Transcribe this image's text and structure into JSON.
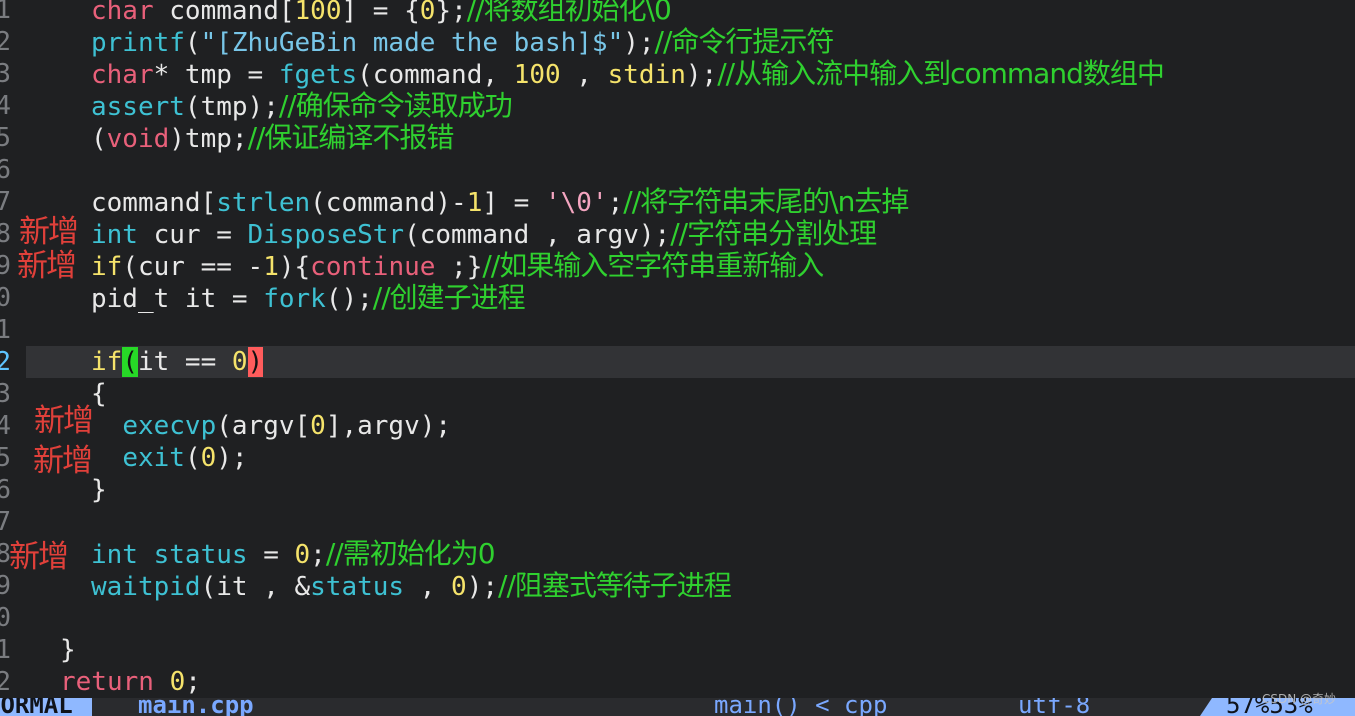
{
  "editor": {
    "lines": [
      {
        "num": "1",
        "code": [
          [
            "tok-type",
            "char"
          ],
          [
            "tok-plain",
            " command["
          ],
          [
            "tok-num",
            "100"
          ],
          [
            "tok-plain",
            "] = {"
          ],
          [
            "tok-num",
            "0"
          ],
          [
            "tok-plain",
            "};"
          ],
          [
            "cmt",
            "//将数组初始化\\0"
          ]
        ]
      },
      {
        "num": "2",
        "code": [
          [
            "tok-fn",
            "printf"
          ],
          [
            "tok-plain",
            "("
          ],
          [
            "tok-str",
            "\"[ZhuGeBin made the bash]$\""
          ],
          [
            "tok-plain",
            ");"
          ],
          [
            "cmt",
            "//命令行提示符"
          ]
        ]
      },
      {
        "num": "3",
        "code": [
          [
            "tok-type",
            "char"
          ],
          [
            "tok-plain",
            "* tmp = "
          ],
          [
            "tok-fn",
            "fgets"
          ],
          [
            "tok-plain",
            "(command, "
          ],
          [
            "tok-num",
            "100"
          ],
          [
            "tok-plain",
            " , "
          ],
          [
            "tok-num",
            "stdin"
          ],
          [
            "tok-plain",
            ");"
          ],
          [
            "cmt",
            "//从输入流中输入到command数组中"
          ]
        ]
      },
      {
        "num": "4",
        "code": [
          [
            "tok-fn",
            "assert"
          ],
          [
            "tok-plain",
            "(tmp);"
          ],
          [
            "cmt",
            "//确保命令读取成功"
          ]
        ]
      },
      {
        "num": "5",
        "code": [
          [
            "tok-plain",
            "("
          ],
          [
            "tok-type",
            "void"
          ],
          [
            "tok-plain",
            ")tmp;"
          ],
          [
            "cmt",
            "//保证编译不报错"
          ]
        ]
      },
      {
        "num": "6",
        "code": []
      },
      {
        "num": "7",
        "code": [
          [
            "tok-plain",
            "command["
          ],
          [
            "tok-fn",
            "strlen"
          ],
          [
            "tok-plain",
            "(command)-"
          ],
          [
            "tok-num",
            "1"
          ],
          [
            "tok-plain",
            "] = "
          ],
          [
            "tok-chr",
            "'\\0'"
          ],
          [
            "tok-plain",
            ";"
          ],
          [
            "cmt",
            "//将字符串末尾的\\n去掉"
          ]
        ]
      },
      {
        "num": "8",
        "code": [
          [
            "tok-fn",
            "int"
          ],
          [
            "tok-plain",
            " cur = "
          ],
          [
            "tok-fn",
            "DisposeStr"
          ],
          [
            "tok-plain",
            "(command , argv);"
          ],
          [
            "cmt",
            "//字符串分割处理"
          ]
        ]
      },
      {
        "num": "9",
        "code": [
          [
            "tok-kw",
            "if"
          ],
          [
            "tok-plain",
            "(cur == -"
          ],
          [
            "tok-num",
            "1"
          ],
          [
            "tok-plain",
            "){"
          ],
          [
            "tok-ctl",
            "continue"
          ],
          [
            "tok-plain",
            " ;}"
          ],
          [
            "cmt",
            "//如果输入空字符串重新输入"
          ]
        ]
      },
      {
        "num": "0",
        "code": [
          [
            "tok-plain",
            "pid_t it = "
          ],
          [
            "tok-fn",
            "fork"
          ],
          [
            "tok-plain",
            "();"
          ],
          [
            "cmt",
            "//创建子进程"
          ]
        ]
      },
      {
        "num": "1",
        "code": []
      },
      {
        "num": "2",
        "code": [
          [
            "tok-kw",
            "if"
          ],
          [
            "hl-open",
            "("
          ],
          [
            "tok-plain",
            "it == "
          ],
          [
            "tok-num",
            "0"
          ],
          [
            "hl-close",
            ")"
          ]
        ]
      },
      {
        "num": "3",
        "code": [
          [
            "tok-plain",
            "{"
          ]
        ]
      },
      {
        "num": "4",
        "code": [
          [
            "tok-plain",
            "  "
          ],
          [
            "tok-fn",
            "execvp"
          ],
          [
            "tok-plain",
            "(argv["
          ],
          [
            "tok-num",
            "0"
          ],
          [
            "tok-plain",
            "],argv);"
          ]
        ]
      },
      {
        "num": "5",
        "code": [
          [
            "tok-plain",
            "  "
          ],
          [
            "tok-fn",
            "exit"
          ],
          [
            "tok-plain",
            "("
          ],
          [
            "tok-num",
            "0"
          ],
          [
            "tok-plain",
            ");"
          ]
        ]
      },
      {
        "num": "6",
        "code": [
          [
            "tok-plain",
            "}"
          ]
        ]
      },
      {
        "num": "7",
        "code": []
      },
      {
        "num": "8",
        "code": [
          [
            "tok-fn",
            "int"
          ],
          [
            "tok-plain",
            " "
          ],
          [
            "tok-fn",
            "status"
          ],
          [
            "tok-plain",
            " = "
          ],
          [
            "tok-num",
            "0"
          ],
          [
            "tok-plain",
            ";"
          ],
          [
            "cmt",
            "//需初始化为0"
          ]
        ]
      },
      {
        "num": "9",
        "code": [
          [
            "tok-fn",
            "waitpid"
          ],
          [
            "tok-plain",
            "(it , &"
          ],
          [
            "tok-fn",
            "status"
          ],
          [
            "tok-plain",
            " , "
          ],
          [
            "tok-num",
            "0"
          ],
          [
            "tok-plain",
            ");"
          ],
          [
            "cmt",
            "//阻塞式等待子进程"
          ]
        ]
      },
      {
        "num": "0",
        "code": []
      },
      {
        "num": "1",
        "code": [
          [
            "tok-plain",
            "}"
          ]
        ]
      },
      {
        "num": "2",
        "code": [
          [
            "tok-ctl",
            "return"
          ],
          [
            "tok-plain",
            " "
          ],
          [
            "tok-num",
            "0"
          ],
          [
            "tok-plain",
            ";"
          ]
        ]
      }
    ],
    "annotations": [
      "新增",
      "新增",
      "新增",
      "新增",
      "新增"
    ]
  },
  "statusbar": {
    "mode": "NORMAL",
    "file": "main.cpp",
    "function": "main() < cpp",
    "encoding": "utf-8",
    "percent": "57%53%"
  },
  "watermark": "CSDN @奇妙"
}
